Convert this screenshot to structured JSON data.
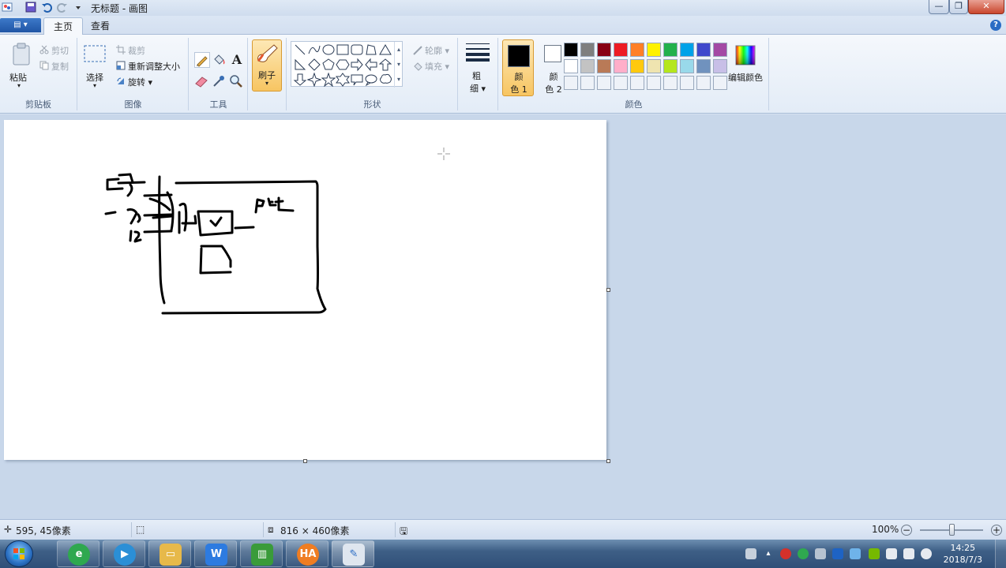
{
  "window": {
    "title": "无标题 - 画图",
    "minimize_label": "—",
    "restore_label": "❐",
    "close_label": "✕"
  },
  "tabs": {
    "app_menu_label": "▤ ▾",
    "home": "主页",
    "view": "查看"
  },
  "ribbon": {
    "clipboard": {
      "group_label": "剪贴板",
      "paste": "粘贴",
      "cut": "剪切",
      "copy": "复制"
    },
    "image": {
      "group_label": "图像",
      "select": "选择",
      "crop": "裁剪",
      "resize": "重新调整大小",
      "rotate": "旋转 ▾"
    },
    "tools": {
      "group_label": "工具"
    },
    "brushes": {
      "label": "刷子"
    },
    "shapes": {
      "group_label": "形状",
      "outline": "轮廓 ▾",
      "fill": "填充 ▾"
    },
    "size": {
      "label_top": "粗",
      "label_bottom": "细 ▾"
    },
    "colors": {
      "group_label": "颜色",
      "color1_top": "颜",
      "color1_bottom": "色 1",
      "color2_top": "颜",
      "color2_bottom": "色 2",
      "color1_value": "#000000",
      "color2_value": "#ffffff",
      "edit_colors": "编辑颜色",
      "palette_row1": [
        "#000000",
        "#7f7f7f",
        "#880015",
        "#ed1c24",
        "#ff7f27",
        "#fff200",
        "#22b14c",
        "#00a2e8",
        "#3f48cc",
        "#a349a4"
      ],
      "palette_row2": [
        "#ffffff",
        "#c3c3c3",
        "#b97a57",
        "#ffaec9",
        "#ffc90e",
        "#efe4b0",
        "#b5e61d",
        "#99d9ea",
        "#7092be",
        "#c8bfe7"
      ]
    }
  },
  "status": {
    "cursor_pos": "595, 45像素",
    "canvas_size": "816 × 460像素",
    "zoom": "100%"
  },
  "taskbar": {
    "time": "14:25",
    "date": "2018/7/3",
    "app_w": "W",
    "app_ha": "HA"
  }
}
